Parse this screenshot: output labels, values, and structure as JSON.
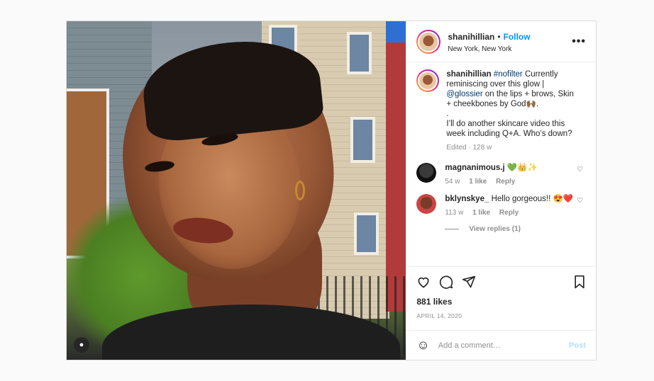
{
  "post": {
    "username": "shanihillian",
    "follow_label": "Follow",
    "location": "New York, New York",
    "more_label": "•••",
    "caption": {
      "username": "shanihillian",
      "hashtag": "#nofilter",
      "text1": " Currently reminiscing over this glow |",
      "mention": "@glossier",
      "text2": " on the lips + brows, Skin + cheekbones by God🙌🏾.",
      "text3": ".",
      "text4": "I’ll do another skincare video this week including Q+A. Who’s down?",
      "meta": "Edited · 128 w"
    },
    "comments": [
      {
        "username": "magnanimous.j",
        "text": "💚👑✨",
        "age": "54 w",
        "likes": "1 like",
        "reply": "Reply"
      },
      {
        "username": "bklynskye_",
        "text": "Hello gorgeous!! 😍❤️",
        "age": "113 w",
        "likes": "1 like",
        "reply": "Reply"
      }
    ],
    "view_replies": "View replies (1)",
    "likes": "881 likes",
    "date": "APRIL 14, 2020",
    "add_comment_placeholder": "Add a comment…",
    "post_button": "Post"
  }
}
